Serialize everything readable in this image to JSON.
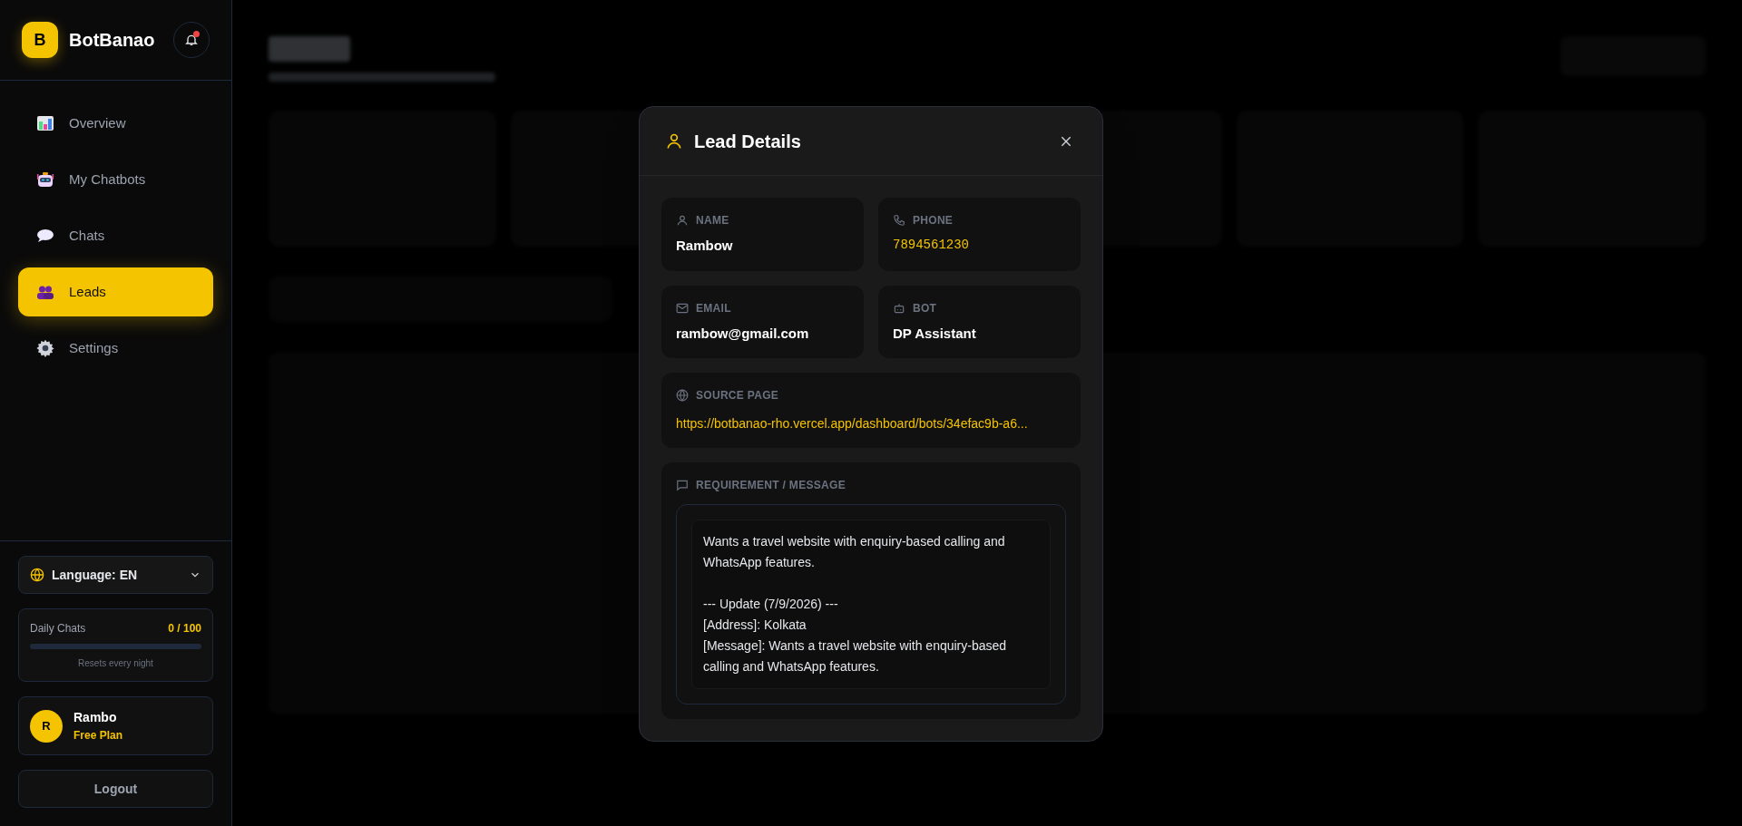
{
  "brand": {
    "logo_letter": "B",
    "name": "BotBanao",
    "notification_unread": true
  },
  "nav": [
    {
      "label": "Overview",
      "selected": false
    },
    {
      "label": "My Chatbots",
      "selected": false
    },
    {
      "label": "Chats",
      "selected": false
    },
    {
      "label": "Leads",
      "selected": true
    },
    {
      "label": "Settings",
      "selected": false
    }
  ],
  "language": {
    "label": "Language: EN"
  },
  "usage": {
    "label": "Daily Chats",
    "count": "0 / 100",
    "level": 0,
    "note": "Resets every night"
  },
  "user": {
    "initial": "R",
    "name": "Rambo",
    "plan": "Free Plan"
  },
  "logout": "Logout",
  "modal": {
    "title": "Lead Details",
    "fields": [
      {
        "kind": "name",
        "label": "NAME",
        "value": "Rambow"
      },
      {
        "kind": "phone",
        "label": "PHONE",
        "value": "7894561230"
      },
      {
        "kind": "email",
        "label": "EMAIL",
        "value": "rambow@gmail.com"
      },
      {
        "kind": "bot",
        "label": "BOT",
        "value": "DP Assistant"
      },
      {
        "kind": "source",
        "label": "SOURCE PAGE",
        "value": "https://botbanao-rho.vercel.app/dashboard/bots/34efac9b-a6..."
      }
    ],
    "message": {
      "label": "REQUIREMENT / MESSAGE",
      "text": "Wants a travel website with enquiry-based calling and WhatsApp features.\n\n--- Update (7/9/2026) ---\n[Address]: Kolkata\n[Message]: Wants a travel website with enquiry-based calling and WhatsApp features."
    }
  }
}
